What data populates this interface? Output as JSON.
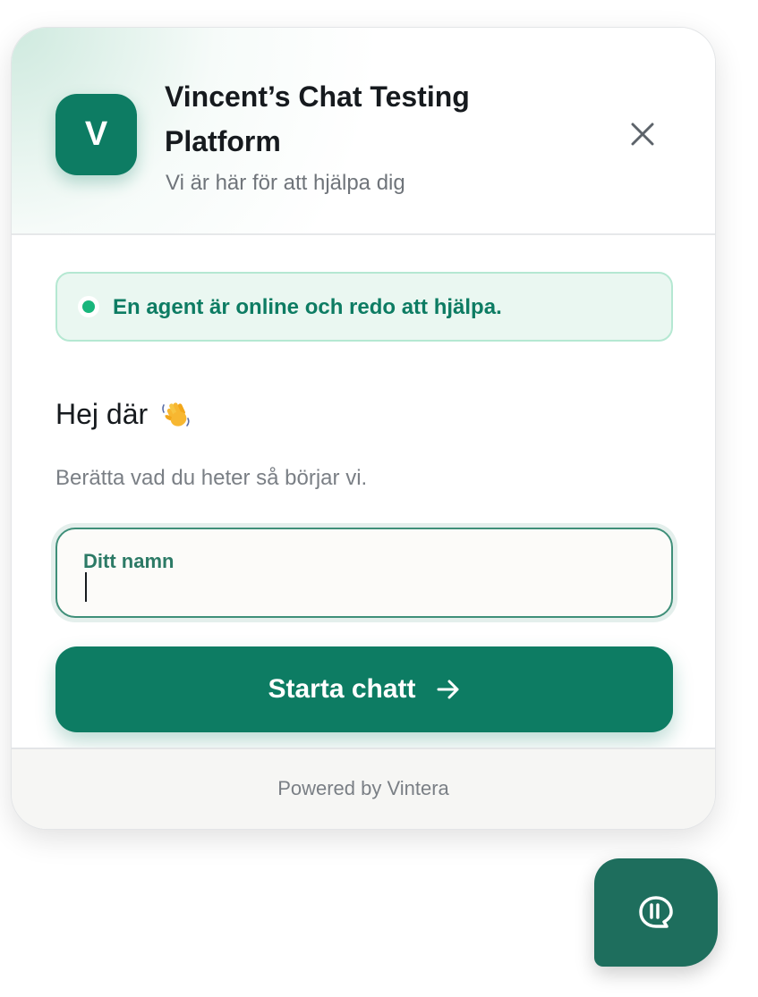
{
  "header": {
    "logo_letter": "V",
    "title": "Vincent’s Chat Testing Platform",
    "subtitle": "Vi är här för att hjälpa dig"
  },
  "status": {
    "text": "En agent är online och redo att hjälpa."
  },
  "greeting": {
    "text": "Hej där",
    "emoji": "waving-hand-icon",
    "prompt": "Berätta vad du heter så börjar vi."
  },
  "name_field": {
    "label": "Ditt namn",
    "value": ""
  },
  "start_button": {
    "label": "Starta chatt"
  },
  "footer": {
    "powered_by": "Powered by Vintera"
  },
  "colors": {
    "brand": "#0d7c63",
    "launcher": "#1e6e5d",
    "online_dot": "#19b67c",
    "status_bg": "#eaf7f1",
    "status_border": "#b5e8d2"
  },
  "icons": {
    "close": "close-icon",
    "arrow": "arrow-right-icon",
    "launcher": "chat-bubble-icon"
  }
}
